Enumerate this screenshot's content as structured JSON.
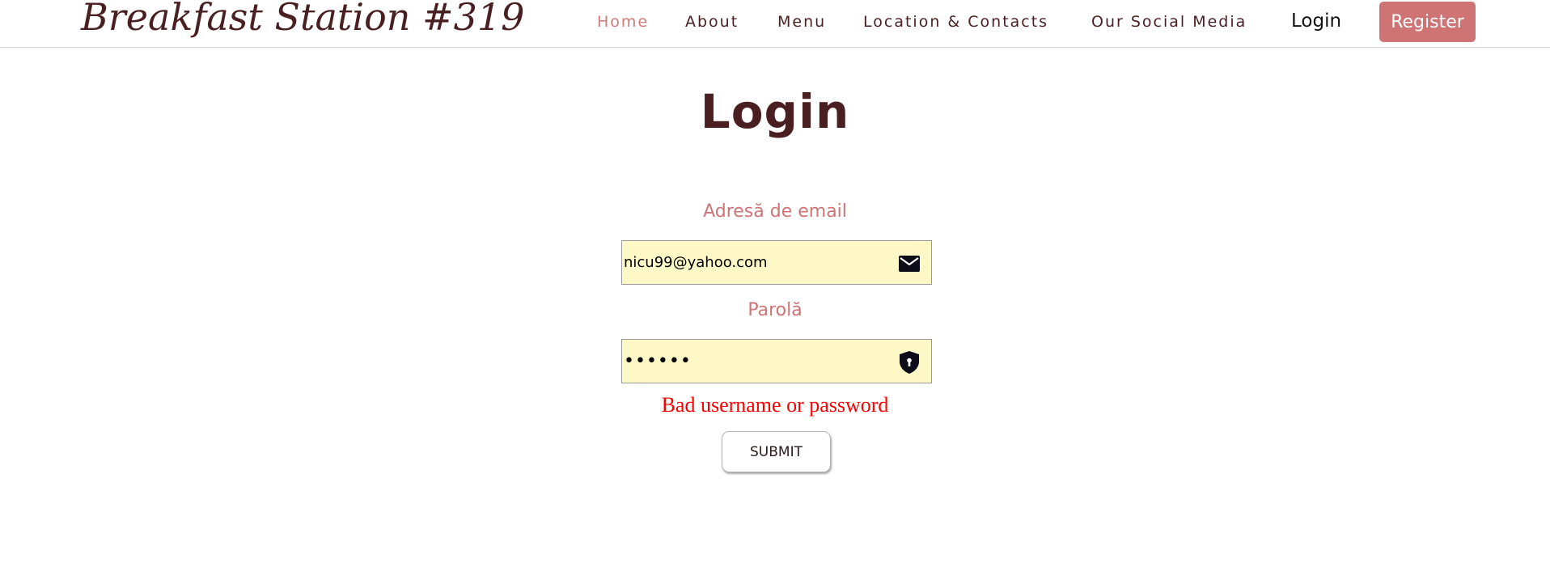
{
  "brand": {
    "name": "Breakfast Station #319"
  },
  "nav": {
    "items": [
      {
        "label": "Home",
        "active": true
      },
      {
        "label": "About",
        "active": false
      },
      {
        "label": "Menu",
        "active": false
      },
      {
        "label": "Location & Contacts",
        "active": false
      },
      {
        "label": "Our Social Media",
        "active": false
      }
    ],
    "login_label": "Login",
    "register_label": "Register"
  },
  "page": {
    "title": "Login"
  },
  "form": {
    "email_label": "Adresă de email",
    "email_value": "nicu99@yahoo.com",
    "email_icon": "envelope-icon",
    "password_label": "Parolă",
    "password_value": "••••••",
    "password_icon": "shield-lock-icon",
    "error_message": "Bad username or password",
    "submit_label": "SUBMIT"
  },
  "colors": {
    "brand_dark": "#4a1f22",
    "accent_pink": "#cf7475",
    "input_background": "#fdf8c6",
    "error_red": "#ff0000"
  }
}
